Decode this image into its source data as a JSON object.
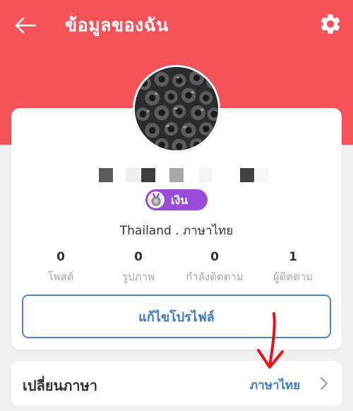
{
  "header": {
    "title": "ข้อมูลของฉัน",
    "back_icon": "arrow-left-icon",
    "settings_icon": "gear-icon",
    "background_color": "#f5525a"
  },
  "profile": {
    "avatar_icon": "avatar-image",
    "badge": {
      "label": "เงิน",
      "icon": "silver-medal-icon",
      "color": "#9b4dd9"
    },
    "location": "Thailand . ภาษาไทย",
    "stats": [
      {
        "value": "0",
        "label": "โพสต์"
      },
      {
        "value": "0",
        "label": "รูปภาพ"
      },
      {
        "value": "0",
        "label": "กำลังติดตาม"
      },
      {
        "value": "1",
        "label": "ผู้ติดตาม"
      }
    ],
    "edit_button": "แก้ไขโปรไฟล์"
  },
  "language": {
    "label": "เปลี่ยนภาษา",
    "value": "ภาษาไทย",
    "accent_color": "#3a7ac2"
  },
  "annotation": {
    "arrow_color": "#e8121f"
  }
}
